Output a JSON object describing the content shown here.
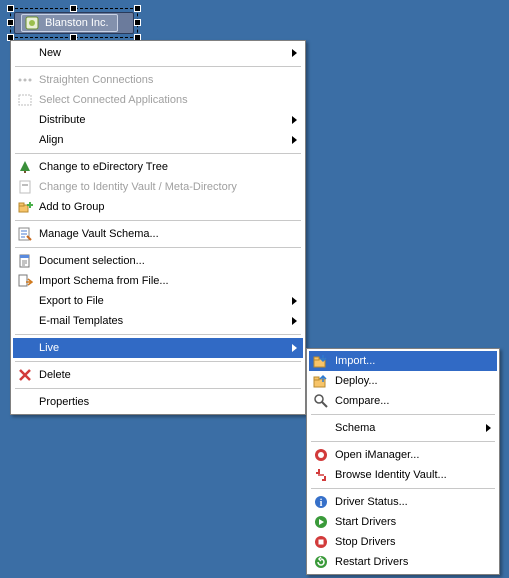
{
  "node": {
    "label": "Blanston Inc."
  },
  "menu1": {
    "new": "New",
    "straighten": "Straighten Connections",
    "select_connected": "Select Connected Applications",
    "distribute": "Distribute",
    "align": "Align",
    "change_edir": "Change to eDirectory Tree",
    "change_idvault": "Change to Identity Vault / Meta-Directory",
    "add_group": "Add to Group",
    "manage_schema": "Manage Vault Schema...",
    "document_selection": "Document selection...",
    "import_schema_file": "Import Schema from File...",
    "export_file": "Export to File",
    "email_templates": "E-mail Templates",
    "live": "Live",
    "delete": "Delete",
    "properties": "Properties"
  },
  "menu2": {
    "import": "Import...",
    "deploy": "Deploy...",
    "compare": "Compare...",
    "schema": "Schema",
    "open_imanager": "Open iManager...",
    "browse_idvault": "Browse Identity Vault...",
    "driver_status": "Driver Status...",
    "start_drivers": "Start Drivers",
    "stop_drivers": "Stop Drivers",
    "restart_drivers": "Restart Drivers"
  }
}
